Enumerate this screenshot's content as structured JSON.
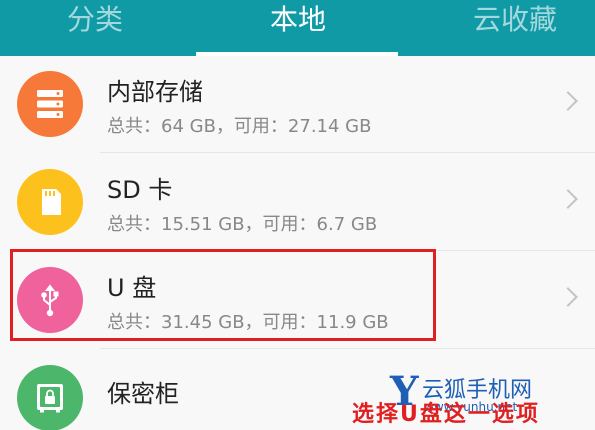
{
  "tabs": [
    {
      "label": "分类"
    },
    {
      "label": "本地"
    },
    {
      "label": "云收藏"
    }
  ],
  "storage_items": [
    {
      "title": "内部存储",
      "subtitle": "总共：64 GB，可用：27.14 GB",
      "icon": "storage-icon",
      "color": "#f7793a"
    },
    {
      "title": "SD 卡",
      "subtitle": "总共：15.51 GB，可用：6.7 GB",
      "icon": "sd-card-icon",
      "color": "#fdc11e"
    },
    {
      "title": "U 盘",
      "subtitle": "总共：31.45 GB，可用：11.9 GB",
      "icon": "usb-icon",
      "color": "#f0629c"
    },
    {
      "title": "保密柜",
      "icon": "safe-icon",
      "color": "#4cb66a"
    }
  ],
  "watermark": {
    "title": "云狐手机网",
    "url": "www.yunhu.net",
    "letter": "Y"
  },
  "annotation": {
    "caption": "选择U盘这一选项"
  },
  "colors": {
    "accent": "#0f9aa5",
    "highlight": "#e02020"
  }
}
